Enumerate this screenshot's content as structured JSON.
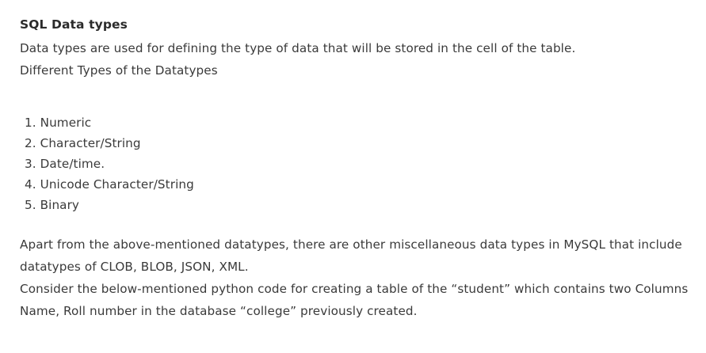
{
  "heading": "SQL Data types",
  "intro": "Data types are used for defining the type of data that will be stored in the cell of the table.",
  "subheading": "Different Types of the Datatypes",
  "datatypes": [
    "1. Numeric",
    "2. Character/String",
    "3. Date/time.",
    "4. Unicode Character/String",
    "5. Binary"
  ],
  "misc_paragraph": "Apart from the above-mentioned datatypes, there are other miscellaneous data types in MySQL that include datatypes of CLOB, BLOB, JSON, XML.",
  "code_intro": "Consider the below-mentioned python code for creating a table of the “student” which contains two Columns Name, Roll number in the database “college” previously created."
}
